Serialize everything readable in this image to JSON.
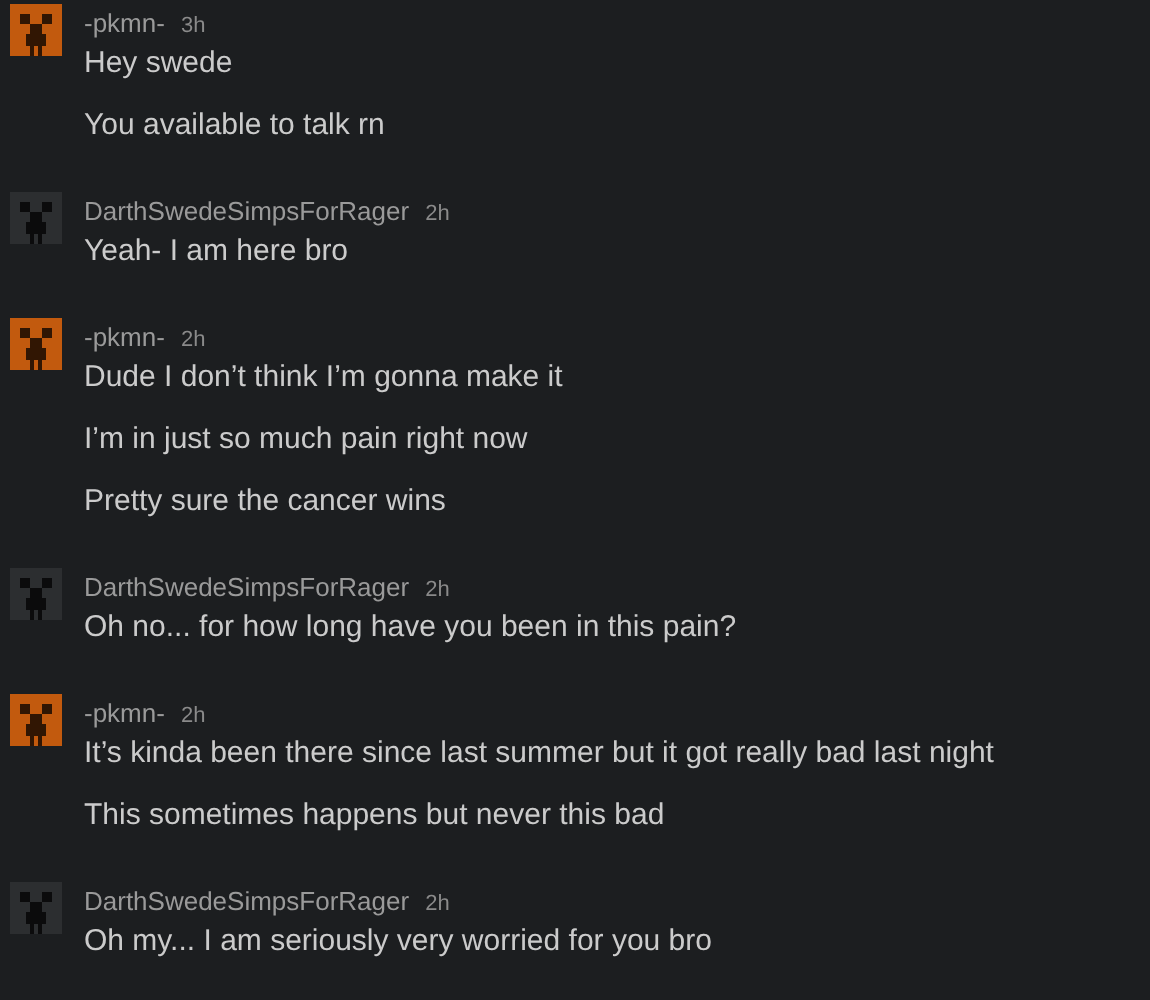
{
  "messages": [
    {
      "author": "-pkmn-",
      "time": "3h",
      "color": "#c25a0e",
      "lines": [
        "Hey swede",
        "You available to talk rn"
      ]
    },
    {
      "author": "DarthSwedeSimpsForRager",
      "time": "2h",
      "color": "#2c2e30",
      "lines": [
        "Yeah- I am here bro"
      ]
    },
    {
      "author": "-pkmn-",
      "time": "2h",
      "color": "#c25a0e",
      "lines": [
        "Dude I don’t think I’m gonna make it",
        "I’m in just so much pain right now",
        "Pretty sure the cancer wins"
      ]
    },
    {
      "author": "DarthSwedeSimpsForRager",
      "time": "2h",
      "color": "#2c2e30",
      "lines": [
        "Oh no... for how long have you been in this pain?"
      ]
    },
    {
      "author": "-pkmn-",
      "time": "2h",
      "color": "#c25a0e",
      "lines": [
        "It’s kinda been there since last summer but it got really bad last night",
        "This sometimes happens but never this bad"
      ]
    },
    {
      "author": "DarthSwedeSimpsForRager",
      "time": "2h",
      "color": "#2c2e30",
      "lines": [
        "Oh my... I am seriously very worried for you bro"
      ]
    }
  ]
}
